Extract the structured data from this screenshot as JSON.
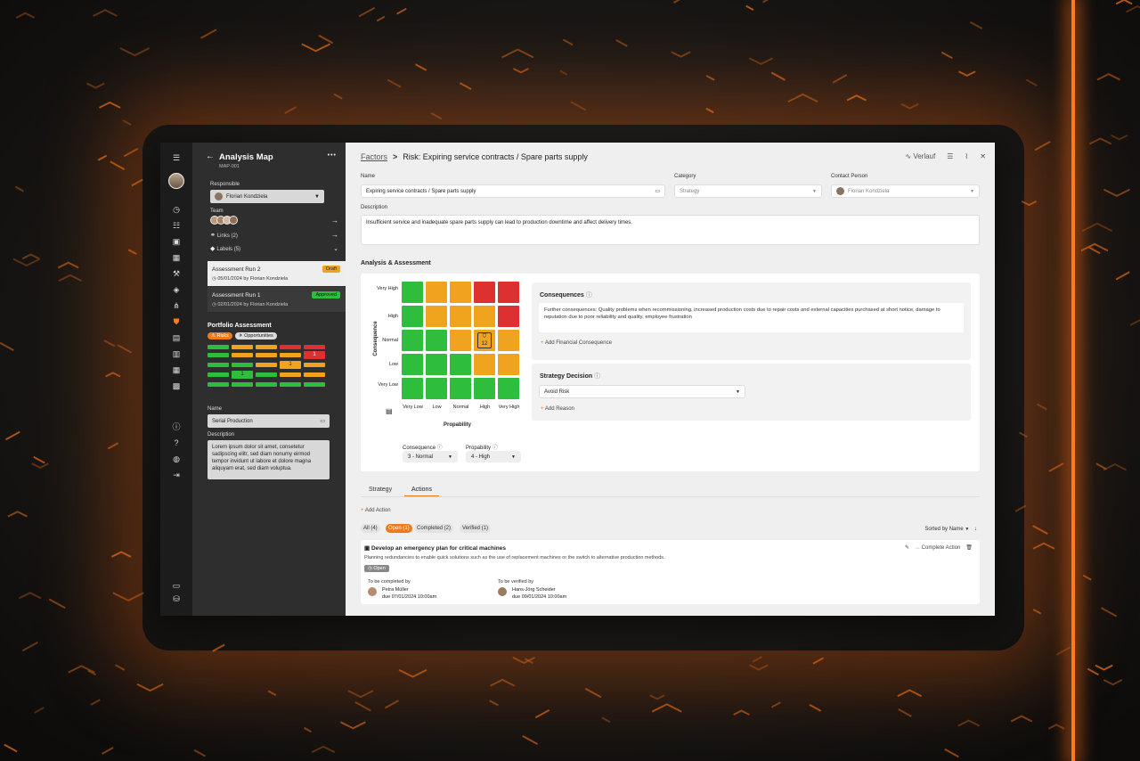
{
  "rail": {
    "icons": [
      "menu-icon",
      "avatar",
      "dashboard-icon",
      "list-icon",
      "clipboard-icon",
      "calendar-icon",
      "wrench-icon",
      "puzzle-icon",
      "org-chart-icon",
      "shield-icon",
      "document-icon",
      "file-icon",
      "table-icon",
      "building-icon",
      "info-icon",
      "help-icon",
      "globe-icon",
      "logout-icon",
      "folder-icon",
      "database-icon"
    ]
  },
  "sidebar": {
    "title": "Analysis Map",
    "subtitle": "MAP-001",
    "menu_label": "•••",
    "responsible_label": "Responsible",
    "responsible_value": "Florian Kondziela",
    "team_label": "Team",
    "links_label": "Links (2)",
    "labels_label": "Labels (5)",
    "runs": [
      {
        "name": "Assessment Run 2",
        "date": "05/01/2024",
        "by": "by Florian Kondziela",
        "badge": "Draft",
        "badge_color": "#f0a31f"
      },
      {
        "name": "Assessment Run 1",
        "date": "02/01/2024",
        "by": "by Florian Kondziela",
        "badge": "Approved",
        "badge_color": "#2fbd3e"
      }
    ],
    "portfolio_title": "Portfolio Assessment",
    "portfolio_tabs": [
      "Risks",
      "Opportunities"
    ],
    "mini_heatmap": [
      [
        "g",
        "o",
        "o",
        "r",
        "r"
      ],
      [
        "g",
        "o",
        "o",
        "o",
        "r1"
      ],
      [
        "g",
        "g",
        "o",
        "o1",
        "o"
      ],
      [
        "g",
        "g1",
        "g",
        "o",
        "o"
      ],
      [
        "g",
        "g",
        "g",
        "g",
        "g"
      ]
    ],
    "mini_counts": {
      "r1": "1",
      "o1": "1",
      "g1": "1"
    },
    "name_label": "Name",
    "name_value": "Serial Production",
    "description_label": "Description",
    "description_value": "Lorem ipsum dolor sit amet, consetetur sadipscing elitr, sed diam nonumy eirmod tempor invidunt ut labore et dolore magna aliquyam erat, sed diam voluptua."
  },
  "header": {
    "breadcrumb_parent": "Factors",
    "breadcrumb_separator": ">",
    "title": "Risk: Expiring service contracts / Spare parts supply",
    "history_label": "Verlauf"
  },
  "form": {
    "name_label": "Name",
    "name_value": "Expiring service contracts / Spare parts supply",
    "category_label": "Category",
    "category_value": "Strategy",
    "contact_label": "Contact Person",
    "contact_value": "Florian Kondziela",
    "description_label": "Description",
    "description_value": "Insufficient service and inadequate spare parts supply can lead to production downtime and affect delivery times."
  },
  "analysis": {
    "section_title": "Analysis & Assessment",
    "y_axis_label": "Consequence",
    "x_axis_label": "Propability",
    "y_levels": [
      "Very High",
      "High",
      "Normal",
      "Low",
      "Very Low"
    ],
    "x_levels": [
      "Very Low",
      "Low",
      "Normal",
      "High",
      "Very High"
    ],
    "matrix": [
      [
        "g",
        "o",
        "o",
        "r",
        "r"
      ],
      [
        "g",
        "o",
        "o",
        "o",
        "r"
      ],
      [
        "g",
        "g",
        "o",
        "o",
        "o"
      ],
      [
        "g",
        "g",
        "g",
        "o",
        "o"
      ],
      [
        "g",
        "g",
        "g",
        "g",
        "g"
      ]
    ],
    "marker_value": "12",
    "consequence_label": "Consequence",
    "consequence_value": "3 - Normal",
    "probability_label": "Propability",
    "probability_value": "4 - High",
    "consequences_title": "Consequences",
    "consequences_text": "Further consequences: Quality problems when recommissioning, increased production costs due to repair costs and external capacities purchased at short notice, damage to reputation due to poor reliability and quality, employee frustration",
    "add_financial": "Add Financial Consequence",
    "strategy_title": "Strategy Decision",
    "strategy_value": "Avoid Risk",
    "add_reason": "Add Reason"
  },
  "tabs": {
    "strategy": "Strategy",
    "actions": "Actions"
  },
  "actions": {
    "add_action": "Add Action",
    "filters": [
      "All (4)",
      "Open (1)",
      "Completed (2)",
      "Verified (1)"
    ],
    "sort_label": "Sorted by Name",
    "item": {
      "title": "Develop an emergency plan for critical machines",
      "description": "Planning redundancies to enable quick solutions such as the use of replacement machines or the switch to alternative production methods.",
      "status": "Open",
      "complete_label": "Complete Action",
      "completed_by_label": "To be completed by",
      "completed_by_name": "Petra Müller",
      "completed_by_due": "due 07/01/2024 10:00am",
      "verified_by_label": "To be verified by",
      "verified_by_name": "Hans-Jörg Scheider",
      "verified_by_due": "due 09/01/2024 10:00am"
    }
  },
  "colors": {
    "accent": "#f07a1a",
    "green": "#2fbd3e",
    "orange": "#efa31f",
    "red": "#dd3131"
  }
}
